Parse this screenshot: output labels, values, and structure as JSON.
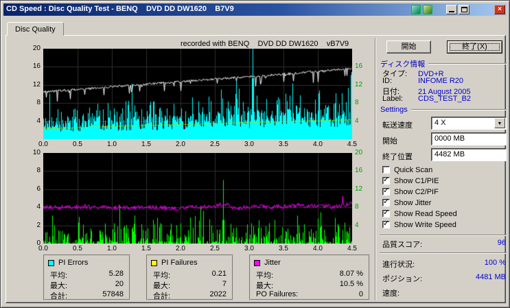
{
  "window": {
    "title": "CD Speed : Disc Quality Test - BENQ    DVD DD DW1620    B7V9"
  },
  "tabs": [
    {
      "label": "Disc Quality",
      "selected": true
    }
  ],
  "chart_header": "recorded with BENQ    DVD DD DW1620    vB7V9",
  "buttons": {
    "start": "開始",
    "exit": "終了(X)"
  },
  "disc_info": {
    "title": "ディスク情報",
    "rows": [
      {
        "label": "タイプ:",
        "value": "DVD+R"
      },
      {
        "label": "ID:",
        "value": "INFOME R20"
      },
      {
        "label": "日付:",
        "value": "21 August 2005"
      },
      {
        "label": "Label:",
        "value": "CDS_TEST_B2"
      }
    ]
  },
  "settings": {
    "title": "Settings",
    "speed_label": "転送速度",
    "speed_value": "4 X",
    "start_label": "開始",
    "start_value": "0000 MB",
    "end_label": "終了位置",
    "end_value": "4482 MB"
  },
  "checkboxes": [
    {
      "label": "Quick Scan",
      "checked": false
    },
    {
      "label": "Show C1/PIE",
      "checked": true
    },
    {
      "label": "Show C2/PIF",
      "checked": true
    },
    {
      "label": "Show Jitter",
      "checked": true
    },
    {
      "label": "Show Read Speed",
      "checked": true
    },
    {
      "label": "Show Write Speed",
      "checked": true
    }
  ],
  "status": {
    "rows": [
      {
        "label": "品質スコア:",
        "value": "96"
      },
      {
        "label": "進行状況:",
        "value": "100 %"
      },
      {
        "label": "ポジション:",
        "value": "4481 MB"
      },
      {
        "label": "速度:",
        "value": ""
      }
    ]
  },
  "legend": [
    {
      "title": "PI Errors",
      "color": "#00FFFF",
      "rows": [
        {
          "label": "平均:",
          "value": "5.28"
        },
        {
          "label": "最大:",
          "value": "20"
        },
        {
          "label": "合計:",
          "value": "57848"
        }
      ]
    },
    {
      "title": "PI Failures",
      "color": "#FFFF00",
      "rows": [
        {
          "label": "平均:",
          "value": "0.21"
        },
        {
          "label": "最大:",
          "value": "7"
        },
        {
          "label": "合計:",
          "value": "2022"
        }
      ]
    },
    {
      "title": "Jitter",
      "color": "#FF00FF",
      "rows": [
        {
          "label": "平均:",
          "value": "8.07 %"
        },
        {
          "label": "最大:",
          "value": "10.5 %"
        },
        {
          "label": "PO Failures:",
          "value": "0"
        }
      ]
    }
  ],
  "colors": {
    "dialog_background": "#D4D0C8",
    "titlebar_start": "#0A246A",
    "titlebar_end": "#A6CAF0",
    "value_text": "#0000D0",
    "section_header": "#0000C0"
  },
  "chart_data": [
    {
      "type": "area",
      "name": "pie-errors-and-speed",
      "x_unit": "GB",
      "x_range": [
        0,
        4.5
      ],
      "x_ticks": [
        "0.0",
        "0.5",
        "1.0",
        "1.5",
        "2.0",
        "2.5",
        "3.0",
        "3.5",
        "4.0",
        "4.5"
      ],
      "left_axis": {
        "label": "PI Errors",
        "range": [
          0,
          20
        ]
      },
      "left_ticks": [
        "20",
        "16",
        "12",
        "8",
        "4"
      ],
      "right_axis": {
        "label": "Speed (X)",
        "range": [
          0,
          20
        ]
      },
      "right_ticks": [
        "16",
        "12",
        "8",
        "4"
      ],
      "right_axis_color": "#00A000",
      "grid": true,
      "series": [
        {
          "name": "C1/PIE errors",
          "type": "spikes",
          "color": "#00FFFF",
          "avg": 5.28,
          "max": 20,
          "total": 57848,
          "peak_at_gb": 3.05
        },
        {
          "name": "read speed",
          "type": "line",
          "color": "#FFFFFF",
          "start": 10.7,
          "end": 15.8
        },
        {
          "name": "write speed",
          "type": "line",
          "color": "#A8E000",
          "start": 2.3,
          "end": 4.3
        }
      ],
      "seed": 1337
    },
    {
      "type": "spikes",
      "name": "pif-and-jitter",
      "x_unit": "GB",
      "x_range": [
        0,
        4.5
      ],
      "x_ticks": [
        "0.0",
        "0.5",
        "1.0",
        "1.5",
        "2.0",
        "2.5",
        "3.0",
        "3.5",
        "4.0",
        "4.5"
      ],
      "left_axis": {
        "label": "PI Failures",
        "range": [
          0,
          10
        ]
      },
      "left_ticks": [
        "10",
        "8",
        "6",
        "4",
        "2",
        "0"
      ],
      "right_axis": {
        "label": "Jitter %",
        "range": [
          0,
          20
        ]
      },
      "right_ticks": [
        "20",
        "16",
        "12",
        "8",
        "4"
      ],
      "right_axis_color": "#00A000",
      "grid": true,
      "series": [
        {
          "name": "C2/PIF failures",
          "type": "spikes",
          "color": "#00FF00",
          "avg": 0.21,
          "max": 7,
          "total": 2022,
          "peak_at_gb": 2.62
        },
        {
          "name": "jitter",
          "type": "noisy-line",
          "color": "#FF00FF",
          "avg": 8.07,
          "max": 10.5,
          "axis": "right"
        }
      ],
      "seed": 4242
    }
  ]
}
